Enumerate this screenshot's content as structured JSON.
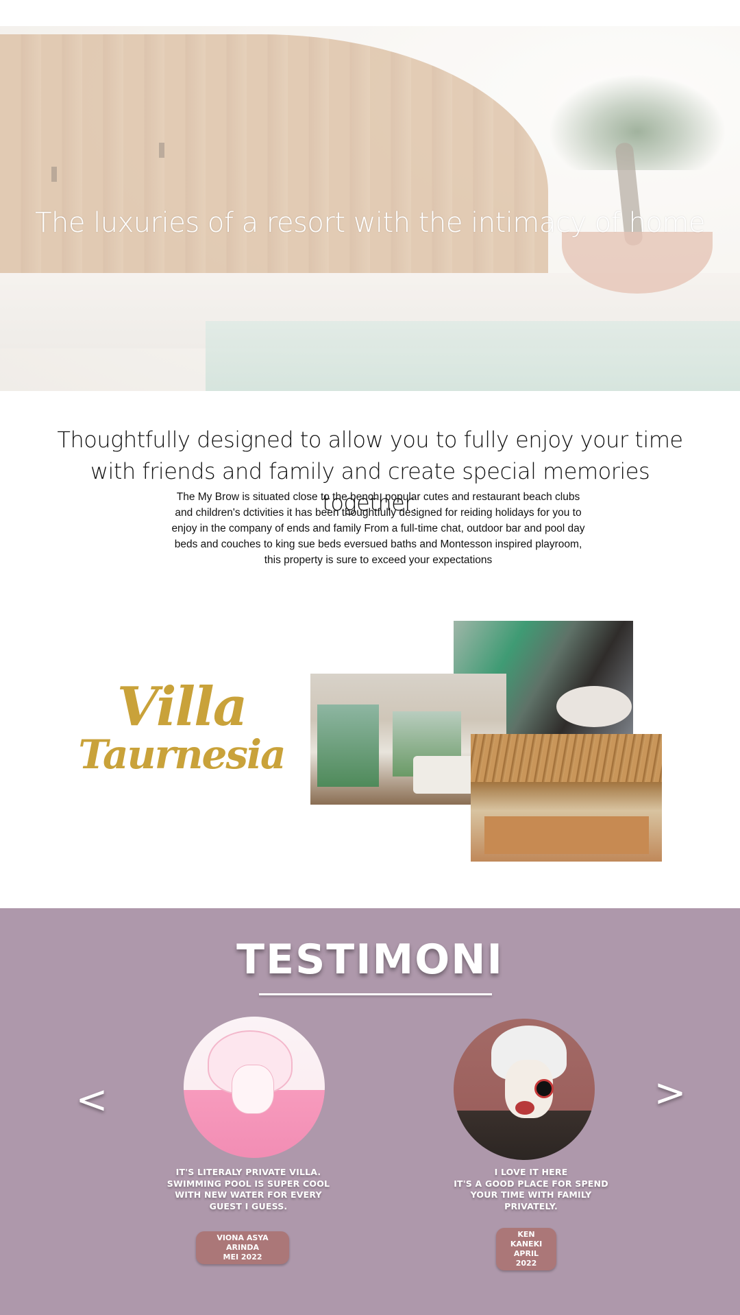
{
  "hero": {
    "title": "The luxuries of a resort with the intimacy of home"
  },
  "intro": {
    "heading_line1": "Thoughtfully designed to allow you to fully enjoy your time",
    "heading_line2": "with friends and family and create special memories together.",
    "body": "The My Brow is situated close to the bench, popular cutes and restaurant beach clubs and children's dctivities it has been thoughtfully designed for reiding holidays for you to enjoy in the company of ends and family From a full-time chat, outdoor bar and pool day beds and couches to king sue beds eversued baths and Montesson inspired playroom, this property is sure to exceed your expectations"
  },
  "villa": {
    "logo_line1": "Villa",
    "logo_line2": "Taurnesia",
    "logo_color": "#c9a23a"
  },
  "testimoni": {
    "title": "TESTIMONI",
    "background": "#ae98ab",
    "prev_label": "<",
    "next_label": ">",
    "items": [
      {
        "quote_lines": [
          "IT'S LITERALY PRIVATE VILLA.",
          "SWIMMING POOL IS SUPER COOL",
          "WITH NEW WATER FOR EVERY",
          "GUEST I GUESS."
        ],
        "name": "VIONA ASYA ARINDA",
        "date": "MEI 2022"
      },
      {
        "quote_lines": [
          "I LOVE IT HERE",
          "IT'S A GOOD PLACE FOR SPEND",
          "YOUR TIME WITH FAMILY",
          "PRIVATELY."
        ],
        "name": "KEN KANEKI",
        "date": "APRIL 2022"
      }
    ],
    "badge_color": "#ab7778"
  },
  "icons": {
    "prev": "chevron-left-icon",
    "next": "chevron-right-icon"
  }
}
